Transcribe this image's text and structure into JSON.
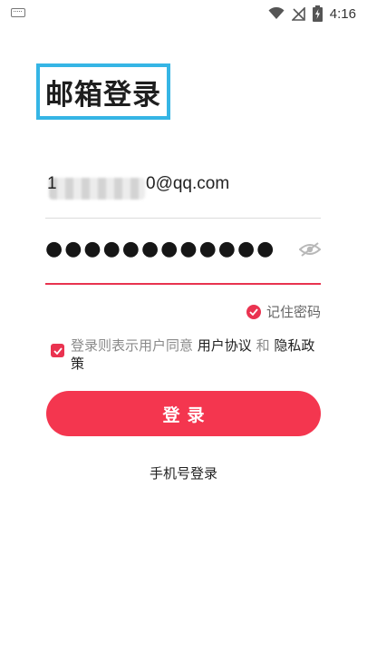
{
  "status_bar": {
    "time": "4:16",
    "icons": [
      "keyboard-icon",
      "wifi-icon",
      "no-signal-icon",
      "battery-charging-icon"
    ]
  },
  "title": "邮箱登录",
  "email": {
    "visible_prefix": "1",
    "visible_suffix": "0@qq.com"
  },
  "password": {
    "masked_value": "●●●●●●●●●●●●",
    "visibility_icon": "eye-closed-icon"
  },
  "remember": {
    "label": "记住密码",
    "checked": true
  },
  "agreement": {
    "checked": true,
    "prefix": "登录则表示用户同意 ",
    "user_agreement": "用户协议",
    "conjunction": " 和 ",
    "privacy_policy": "隐私政策"
  },
  "login_button": {
    "label": "登录"
  },
  "phone_login_link": "手机号登录",
  "colors": {
    "accent": "#f4364f",
    "title_highlight": "#35b5e5",
    "placeholder_text": "#8a8a8a"
  }
}
